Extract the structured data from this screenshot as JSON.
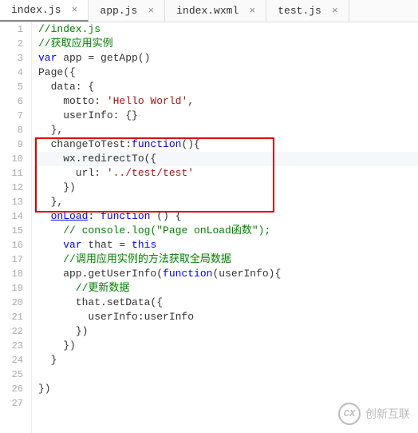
{
  "tabs": [
    {
      "label": "index.js",
      "active": true
    },
    {
      "label": "app.js",
      "active": false
    },
    {
      "label": "index.wxml",
      "active": false
    },
    {
      "label": "test.js",
      "active": false
    }
  ],
  "code": {
    "l1": "//index.js",
    "l2": "//获取应用实例",
    "l3a": "var",
    "l3b": " app = getApp()",
    "l4": "Page({",
    "l5": "  data: {",
    "l6a": "    motto: ",
    "l6b": "'Hello World'",
    "l6c": ",",
    "l7": "    userInfo: {}",
    "l8": "  },",
    "l9a": "  changeToTest:",
    "l9b": "function",
    "l9c": "(){",
    "l10": "    wx.redirectTo({",
    "l11a": "      url: ",
    "l11b": "'../test/test'",
    "l12": "    })",
    "l13": "  },",
    "l14a": "  ",
    "l14b": "onLoad",
    "l14c": ": ",
    "l14d": "function",
    "l14e": " () {",
    "l15a": "    ",
    "l15b": "// console.log(\"Page onLoad函数\");",
    "l16a": "    ",
    "l16b": "var",
    "l16c": " that = ",
    "l16d": "this",
    "l17a": "    ",
    "l17b": "//调用应用实例的方法获取全局数据",
    "l18a": "    app.getUserInfo(",
    "l18b": "function",
    "l18c": "(userInfo){",
    "l19a": "      ",
    "l19b": "//更新数据",
    "l20": "      that.setData({",
    "l21": "        userInfo:userInfo",
    "l22": "      })",
    "l23": "    })",
    "l24": "  }",
    "l25": "",
    "l26": "})"
  },
  "lineNumbers": [
    "1",
    "2",
    "3",
    "4",
    "5",
    "6",
    "7",
    "8",
    "9",
    "10",
    "11",
    "12",
    "13",
    "14",
    "15",
    "16",
    "17",
    "18",
    "19",
    "20",
    "21",
    "22",
    "23",
    "24",
    "25",
    "26",
    "27"
  ],
  "watermark": "创新互联"
}
